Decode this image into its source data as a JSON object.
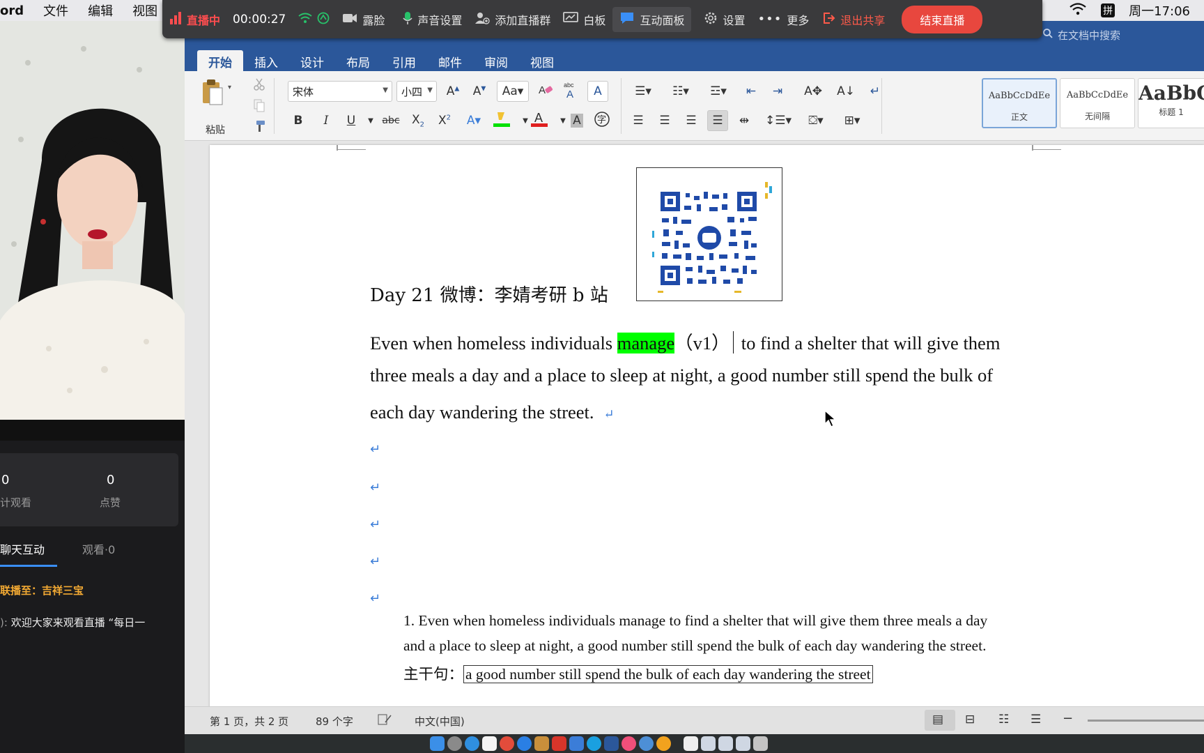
{
  "menubar": {
    "app": "ord",
    "items": [
      "文件",
      "编辑",
      "视图"
    ],
    "clock": "周一17:06",
    "input_method": "拼"
  },
  "livebar": {
    "status": "直播中",
    "timer": "00:00:27",
    "show_face": "露脸",
    "sound": "声音设置",
    "add_group": "添加直播群",
    "whiteboard": "白板",
    "interaction": "互动面板",
    "settings": "设置",
    "more": "更多",
    "exit_share": "退出共享",
    "end_live": "结束直播"
  },
  "left_panel": {
    "watch_count": "0",
    "watch_label": "计观看",
    "like_count": "0",
    "like_label": "点赞",
    "tab_chat": "聊天互动",
    "tab_viewers": "观看·0",
    "chat_line1": "联播至：吉祥三宝",
    "chat_line2_prefix": "):",
    "chat_line2": "欢迎大家来观看直播 “每日一"
  },
  "word": {
    "search_placeholder": "在文档中搜索",
    "tabs": [
      "开始",
      "插入",
      "设计",
      "布局",
      "引用",
      "邮件",
      "审阅",
      "视图"
    ],
    "ribbon": {
      "paste": "粘贴",
      "font": "宋体",
      "size": "小四",
      "styles": [
        {
          "sample": "AaBbCcDdEe",
          "name": "正文"
        },
        {
          "sample": "AaBbCcDdEe",
          "name": "无间隔"
        },
        {
          "sample": "AaBbC",
          "name": "标题 1"
        }
      ]
    },
    "doc": {
      "heading": "Day 21  微博：李婧考研    b 站",
      "para_line1_pre": "Even when homeless individuals ",
      "para_highlight": "manage",
      "para_line1_mid": "（v1）",
      "para_line1_post": " to find a shelter that will give them",
      "para_line2": "three meals a day and a place to sleep at night, a good number still spend the bulk of",
      "para_line3": "each day wandering the street.",
      "return_mark": "↵",
      "note_line1": "1. Even when homeless individuals manage to find a shelter that will give them three meals a day",
      "note_line2": "and a place to sleep at night, a good number still spend the bulk of each day wandering the street.",
      "note_line3_label": "主干句：",
      "note_line3_box": "a good number still spend the bulk of each day wandering the street"
    },
    "status": {
      "page": "第 1 页，共 2 页",
      "words": "89 个字",
      "language": "中文(中国)"
    }
  },
  "colors": {
    "word_blue": "#2b579a",
    "highlight": "#00ff00",
    "live_red": "#e8473e",
    "chat_orange": "#f2a933"
  }
}
